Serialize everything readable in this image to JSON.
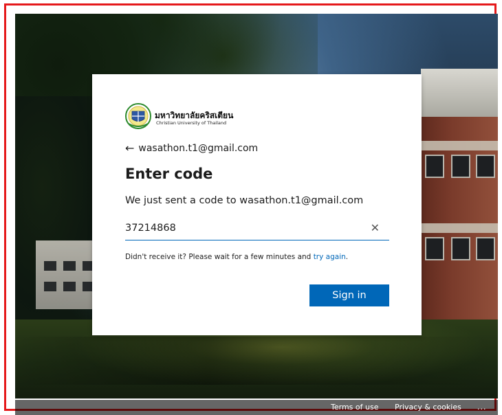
{
  "brand": {
    "name_th": "มหาวิทยาลัยคริสเตียน",
    "name_en": "Christian University of Thailand"
  },
  "signin": {
    "identity": "wasathon.t1@gmail.com",
    "title": "Enter code",
    "description": "We just sent a code to wasathon.t1@gmail.com",
    "code_value": "37214868",
    "help_prefix": "Didn't receive it? Please wait for a few minutes and ",
    "help_link": "try again",
    "help_suffix": ".",
    "submit_label": "Sign in"
  },
  "footer": {
    "terms": "Terms of use",
    "privacy": "Privacy & cookies",
    "more": "..."
  },
  "icons": {
    "back": "back-arrow-icon",
    "clear": "clear-icon",
    "logo": "university-seal-icon"
  },
  "colors": {
    "accent": "#0067b8",
    "outline": "#e5191b"
  }
}
